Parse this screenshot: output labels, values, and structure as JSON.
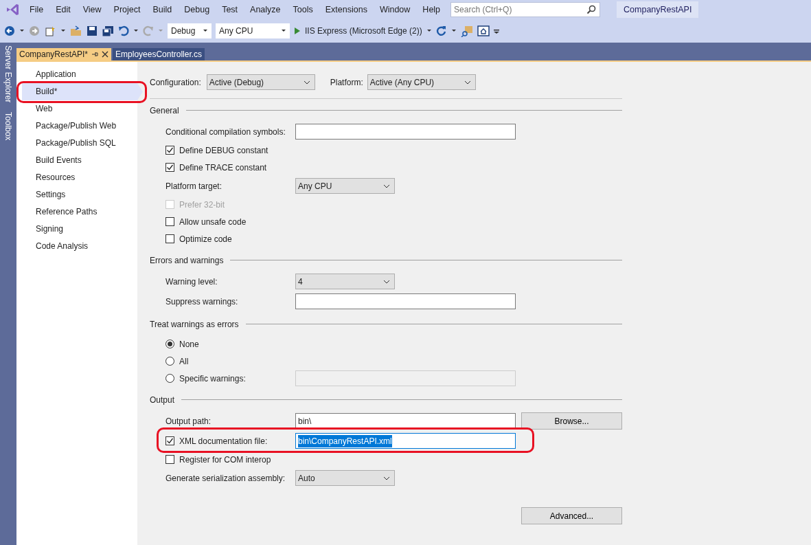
{
  "menu": [
    "File",
    "Edit",
    "View",
    "Project",
    "Build",
    "Debug",
    "Test",
    "Analyze",
    "Tools",
    "Extensions",
    "Window",
    "Help"
  ],
  "search": {
    "placeholder": "Search (Ctrl+Q)"
  },
  "solution_title": "CompanyRestAPI",
  "toolbar": {
    "configuration": "Debug",
    "platform": "Any CPU",
    "run_target": "IIS Express (Microsoft Edge (2))"
  },
  "side_tabs": [
    "Server Explorer",
    "Toolbox"
  ],
  "doc_tabs": [
    {
      "label": "CompanyRestAPI*",
      "selected": true
    },
    {
      "label": "EmployeesController.cs",
      "selected": false
    }
  ],
  "nav": [
    {
      "label": "Application",
      "selected": false,
      "highlighted": false
    },
    {
      "label": "Build*",
      "selected": true,
      "highlighted": true
    },
    {
      "label": "Web",
      "selected": false,
      "highlighted": false
    },
    {
      "label": "Package/Publish Web",
      "selected": false,
      "highlighted": false
    },
    {
      "label": "Package/Publish SQL",
      "selected": false,
      "highlighted": false
    },
    {
      "label": "Build Events",
      "selected": false,
      "highlighted": false
    },
    {
      "label": "Resources",
      "selected": false,
      "highlighted": false
    },
    {
      "label": "Settings",
      "selected": false,
      "highlighted": false
    },
    {
      "label": "Reference Paths",
      "selected": false,
      "highlighted": false
    },
    {
      "label": "Signing",
      "selected": false,
      "highlighted": false
    },
    {
      "label": "Code Analysis",
      "selected": false,
      "highlighted": false
    }
  ],
  "config_bar": {
    "configuration_label": "Configuration:",
    "configuration": "Active (Debug)",
    "platform_label": "Platform:",
    "platform": "Active (Any CPU)"
  },
  "sections": [
    {
      "title": "General",
      "rows": [
        {
          "kind": "text",
          "label": "Conditional compilation symbols:",
          "value": ""
        },
        {
          "kind": "check",
          "label": "Define DEBUG constant",
          "checked": true,
          "disabled": false
        },
        {
          "kind": "check",
          "label": "Define TRACE constant",
          "checked": true,
          "disabled": false
        },
        {
          "kind": "select",
          "label": "Platform target:",
          "value": "Any CPU"
        },
        {
          "kind": "check",
          "label": "Prefer 32-bit",
          "checked": false,
          "disabled": true
        },
        {
          "kind": "check",
          "label": "Allow unsafe code",
          "checked": false,
          "disabled": false
        },
        {
          "kind": "check",
          "label": "Optimize code",
          "checked": false,
          "disabled": false
        }
      ]
    },
    {
      "title": "Errors and warnings",
      "rows": [
        {
          "kind": "select",
          "label": "Warning level:",
          "value": "4"
        },
        {
          "kind": "text",
          "label": "Suppress warnings:",
          "value": ""
        }
      ]
    },
    {
      "title": "Treat warnings as errors",
      "rows": [
        {
          "kind": "radio",
          "label": "None",
          "selected": true
        },
        {
          "kind": "radio",
          "label": "All",
          "selected": false
        },
        {
          "kind": "radio",
          "label": "Specific warnings:",
          "selected": false,
          "field_disabled": true
        }
      ]
    },
    {
      "title": "Output",
      "rows": [
        {
          "kind": "text",
          "label": "Output path:",
          "value": "bin\\",
          "button": "Browse..."
        },
        {
          "kind": "checktext",
          "label": "XML documentation file:",
          "checked": true,
          "value": "bin\\CompanyRestAPI.xml",
          "highlighted": true
        },
        {
          "kind": "check",
          "label": "Register for COM interop",
          "checked": false,
          "disabled": false
        },
        {
          "kind": "select",
          "label": "Generate serialization assembly:",
          "value": "Auto"
        }
      ]
    }
  ],
  "advanced_button": "Advanced..."
}
